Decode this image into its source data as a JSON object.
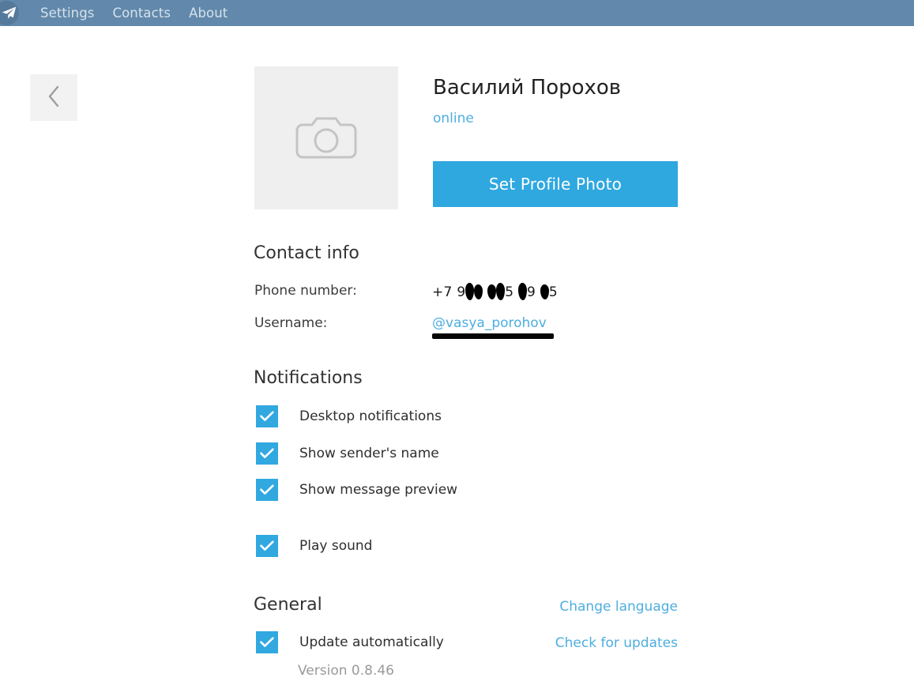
{
  "titlebar": {
    "logo_icon": "telegram-paper-plane-icon",
    "menu": [
      {
        "label": "Settings"
      },
      {
        "label": "Contacts"
      },
      {
        "label": "About"
      }
    ]
  },
  "navigation": {
    "back_icon": "chevron-left-icon"
  },
  "profile": {
    "avatar_placeholder_icon": "camera-icon",
    "name": "Василий Порохов",
    "status": "online",
    "set_photo_button": "Set Profile Photo"
  },
  "contact_info": {
    "title": "Contact info",
    "rows": [
      {
        "label": "Phone number:",
        "value": "+7 9●● ●●5 ●9 ●5",
        "redacted": true
      },
      {
        "label": "Username:",
        "value": "@vasya_porohov",
        "redacted": true
      }
    ]
  },
  "notifications": {
    "title": "Notifications",
    "items": [
      {
        "label": "Desktop notifications",
        "checked": true
      },
      {
        "label": "Show sender's name",
        "checked": true
      },
      {
        "label": "Show message preview",
        "checked": true
      },
      {
        "label": "Play sound",
        "checked": true
      }
    ]
  },
  "general": {
    "title": "General",
    "change_language": "Change language",
    "check_updates": "Check for updates",
    "update_item": {
      "label": "Update automatically",
      "checked": true
    },
    "version": "Version 0.8.46"
  },
  "colors": {
    "titlebar": "#6289ab",
    "accent_blue": "#2fa8e0",
    "link_blue": "#4daee0",
    "checkbox_blue": "#31a8e0",
    "avatar_bg": "#efefef",
    "version_grey": "#9a9a9a"
  }
}
